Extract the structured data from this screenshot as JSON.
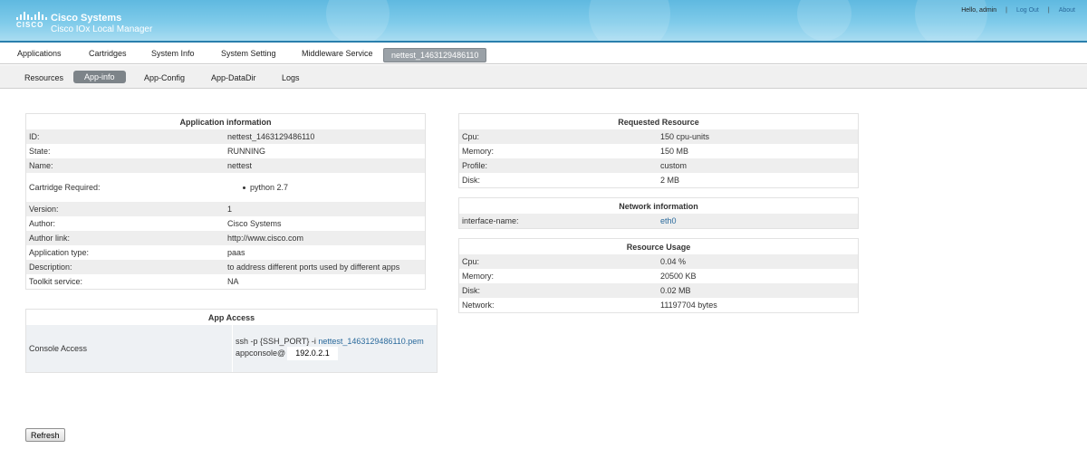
{
  "header": {
    "company": "Cisco Systems",
    "logo_text": "CISCO",
    "product": "Cisco IOx Local Manager",
    "greeting": "Hello, admin",
    "separator": "|",
    "logout": "Log Out",
    "about": "About"
  },
  "main_nav": [
    "Applications",
    "Cartridges",
    "System Info",
    "System Setting",
    "Middleware Service",
    "nettest_1463129486110"
  ],
  "main_nav_active": "nettest_1463129486110",
  "sub_nav": [
    "Resources",
    "App-info",
    "App-Config",
    "App-DataDir",
    "Logs"
  ],
  "sub_nav_active": "App-info",
  "app_info": {
    "title": "Application information",
    "id_label": "ID:",
    "id_value": "nettest_1463129486110",
    "state_label": "State:",
    "state_value": "RUNNING",
    "name_label": "Name:",
    "name_value": "nettest",
    "cartridge_label": "Cartridge Required:",
    "cartridge_value": "python 2.7",
    "version_label": "Version:",
    "version_value": "1",
    "author_label": "Author:",
    "author_value": "Cisco Systems",
    "author_link_label": "Author link:",
    "author_link_value": "http://www.cisco.com",
    "app_type_label": "Application type:",
    "app_type_value": "paas",
    "description_label": "Description:",
    "description_value": "to address different ports used by different apps",
    "toolkit_label": "Toolkit service:",
    "toolkit_value": "NA"
  },
  "app_access": {
    "title": "App Access",
    "console_label": "Console Access",
    "ssh_prefix": "ssh -p {SSH_PORT} -i ",
    "pem_link": "nettest_1463129486110.pem",
    "appconsole_label": "appconsole@",
    "ip_value": "192.0.2.1"
  },
  "requested_resource": {
    "title": "Requested Resource",
    "cpu_label": "Cpu:",
    "cpu_value": "150 cpu-units",
    "memory_label": "Memory:",
    "memory_value": "150 MB",
    "profile_label": "Profile:",
    "profile_value": "custom",
    "disk_label": "Disk:",
    "disk_value": "2 MB"
  },
  "network_info": {
    "title": "Network information",
    "iface_label": "interface-name:",
    "iface_value": "eth0"
  },
  "resource_usage": {
    "title": "Resource Usage",
    "cpu_label": "Cpu:",
    "cpu_value": "0.04 %",
    "memory_label": "Memory:",
    "memory_value": "20500 KB",
    "disk_label": "Disk:",
    "disk_value": "0.02 MB",
    "network_label": "Network:",
    "network_value": "11197704 bytes"
  },
  "buttons": {
    "refresh": "Refresh"
  },
  "colors": {
    "header_blue": "#7fcbea",
    "active_tab": "#7d8489",
    "link": "#2a6a9c"
  }
}
